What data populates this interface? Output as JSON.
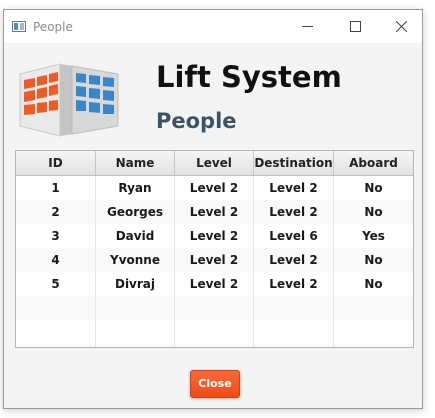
{
  "window": {
    "title": "People",
    "controls": {
      "minimize_icon": "minimize-icon",
      "maximize_icon": "maximize-icon",
      "close_icon": "close-icon"
    }
  },
  "header": {
    "title": "Lift System",
    "subtitle": "People",
    "logo_icon": "building-logo"
  },
  "table": {
    "columns": [
      "ID",
      "Name",
      "Level",
      "Destination",
      "Aboard"
    ],
    "rows": [
      [
        "1",
        "Ryan",
        "Level 2",
        "Level 2",
        "No"
      ],
      [
        "2",
        "Georges",
        "Level 2",
        "Level 2",
        "No"
      ],
      [
        "3",
        "David",
        "Level 2",
        "Level 6",
        "Yes"
      ],
      [
        "4",
        "Yvonne",
        "Level 2",
        "Level 2",
        "No"
      ],
      [
        "5",
        "Divraj",
        "Level 2",
        "Level 2",
        "No"
      ],
      [
        "",
        "",
        "",
        "",
        ""
      ],
      [
        "",
        "",
        "",
        "",
        ""
      ],
      [
        "",
        "",
        "",
        "",
        ""
      ]
    ]
  },
  "footer": {
    "close_label": "Close"
  },
  "colors": {
    "accent": "#f05a24",
    "subtitle": "#3d5364"
  }
}
